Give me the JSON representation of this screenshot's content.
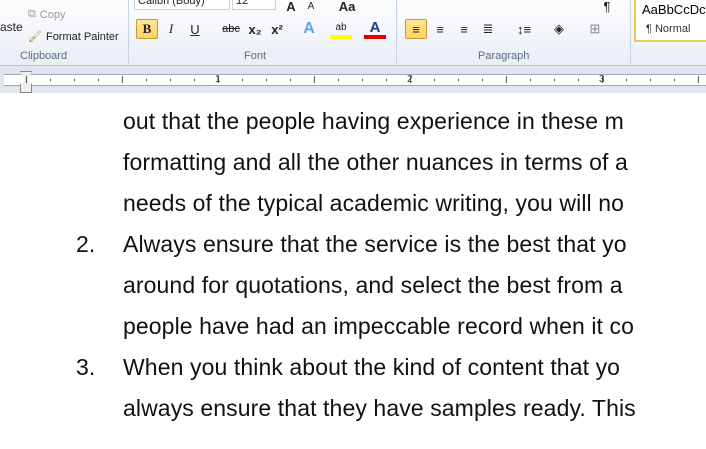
{
  "ribbon": {
    "clipboard": {
      "paste": "aste",
      "copy": "Copy",
      "format_painter": "Format Painter",
      "label": "Clipboard"
    },
    "font": {
      "name": "Calibri (Body)",
      "size": "12",
      "bold": "B",
      "italic": "I",
      "underline": "U",
      "strike": "abc",
      "subscript": "x₂",
      "superscript": "x²",
      "grow": "A",
      "shrink": "A",
      "change_case": "Aa",
      "label": "Font",
      "highlight_color": "#ffff00",
      "font_color": "#e00000"
    },
    "paragraph": {
      "label": "Paragraph",
      "pilcrow": "¶"
    },
    "styles": {
      "preview": "AaBbCcDc",
      "normal": "¶ Normal"
    }
  },
  "ruler": {
    "numbers": [
      "1",
      "2",
      "3"
    ]
  },
  "document": {
    "lines": [
      {
        "num": "",
        "text": "out that the people having experience in these m"
      },
      {
        "num": "",
        "text": "formatting and all the other nuances in terms of a"
      },
      {
        "num": "",
        "text": "needs of the typical academic writing, you will no"
      },
      {
        "num": "2.",
        "text": "Always ensure that the service is the best that yo"
      },
      {
        "num": "",
        "text": "around for quotations, and select the best from a"
      },
      {
        "num": "",
        "text": "people have had an impeccable record when it co"
      },
      {
        "num": "3.",
        "text": "When you think about the kind of content that yo"
      },
      {
        "num": "",
        "text": "always ensure that they have samples ready. This"
      }
    ]
  }
}
